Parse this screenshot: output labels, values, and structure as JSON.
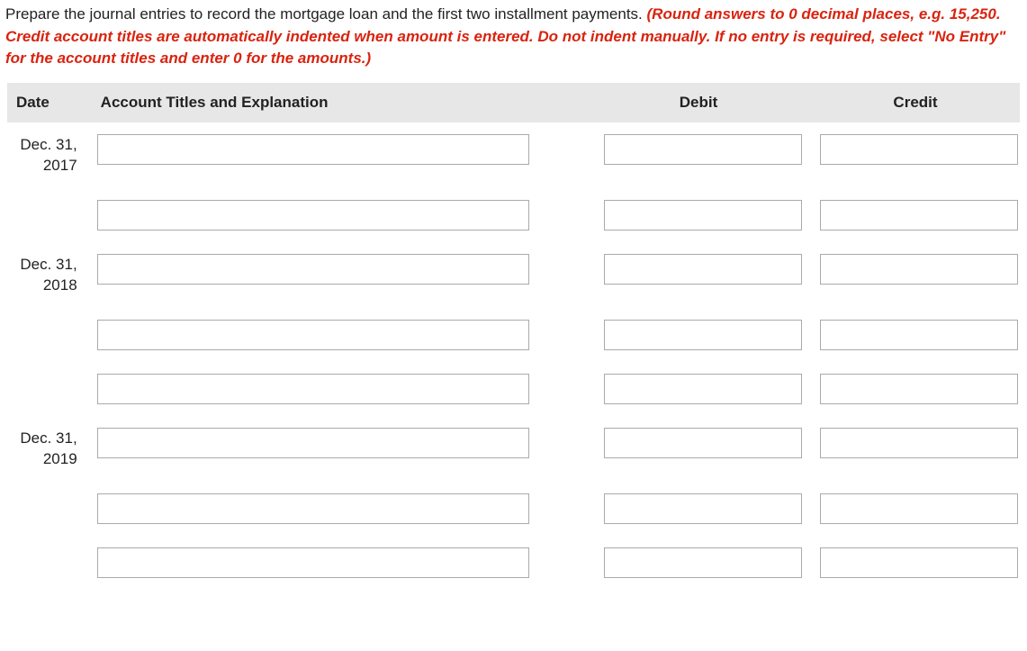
{
  "instructions": {
    "black": "Prepare the journal entries to record the mortgage loan and the first two installment payments. ",
    "red": "(Round answers to 0 decimal places, e.g. 15,250. Credit account titles are automatically indented when amount is entered. Do not indent manually. If no entry is required, select \"No Entry\" for the account titles and enter 0 for the amounts.)"
  },
  "headers": {
    "date": "Date",
    "account": "Account Titles and Explanation",
    "debit": "Debit",
    "credit": "Credit"
  },
  "rows": [
    {
      "date_line1": "Dec. 31,",
      "date_line2": "2017",
      "account": "",
      "debit": "",
      "credit": ""
    },
    {
      "date_line1": "",
      "date_line2": "",
      "account": "",
      "debit": "",
      "credit": ""
    },
    {
      "date_line1": "Dec. 31,",
      "date_line2": "2018",
      "account": "",
      "debit": "",
      "credit": ""
    },
    {
      "date_line1": "",
      "date_line2": "",
      "account": "",
      "debit": "",
      "credit": ""
    },
    {
      "date_line1": "",
      "date_line2": "",
      "account": "",
      "debit": "",
      "credit": ""
    },
    {
      "date_line1": "Dec. 31,",
      "date_line2": "2019",
      "account": "",
      "debit": "",
      "credit": ""
    },
    {
      "date_line1": "",
      "date_line2": "",
      "account": "",
      "debit": "",
      "credit": ""
    },
    {
      "date_line1": "",
      "date_line2": "",
      "account": "",
      "debit": "",
      "credit": ""
    }
  ]
}
